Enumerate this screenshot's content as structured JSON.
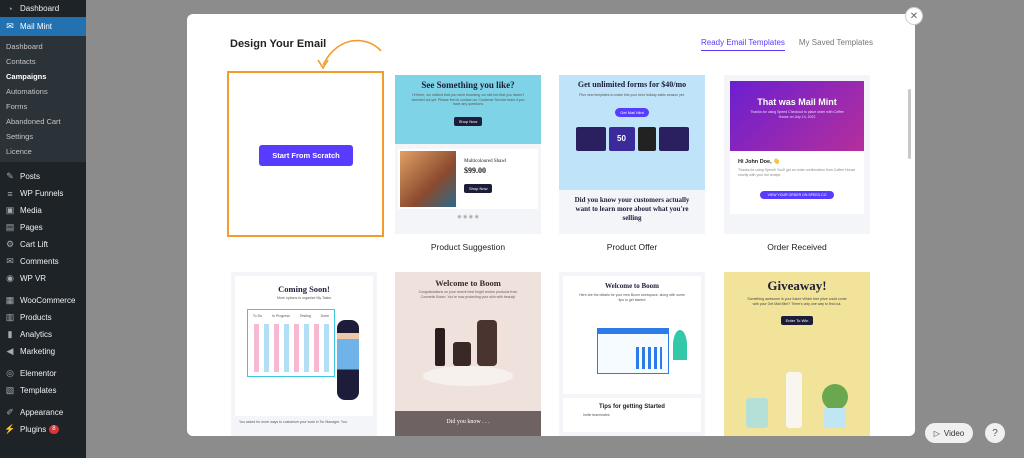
{
  "sidebar": {
    "top": [
      {
        "label": "Dashboard",
        "icon": "dashboard-icon",
        "glyph": "◔"
      },
      {
        "label": "Mail Mint",
        "icon": "mail-icon",
        "glyph": "✉",
        "active": true
      }
    ],
    "submenu": [
      "Dashboard",
      "Contacts",
      "Campaigns",
      "Automations",
      "Forms",
      "Abandoned Cart",
      "Settings",
      "Licence"
    ],
    "current_sub": "Campaigns",
    "items": [
      {
        "label": "Posts",
        "icon": "pin-icon",
        "glyph": "✎"
      },
      {
        "label": "WP Funnels",
        "icon": "funnel-icon",
        "glyph": "≡"
      },
      {
        "label": "Media",
        "icon": "media-icon",
        "glyph": "▣"
      },
      {
        "label": "Pages",
        "icon": "pages-icon",
        "glyph": "▤"
      },
      {
        "label": "Cart Lift",
        "icon": "cart-icon",
        "glyph": "⚙"
      },
      {
        "label": "Comments",
        "icon": "comment-icon",
        "glyph": "✉"
      },
      {
        "label": "WP VR",
        "icon": "vr-icon",
        "glyph": "◉"
      },
      {
        "label": "WooCommerce",
        "icon": "woo-icon",
        "glyph": "▦"
      },
      {
        "label": "Products",
        "icon": "products-icon",
        "glyph": "▥"
      },
      {
        "label": "Analytics",
        "icon": "analytics-icon",
        "glyph": "▮"
      },
      {
        "label": "Marketing",
        "icon": "megaphone-icon",
        "glyph": "◀"
      },
      {
        "label": "Elementor",
        "icon": "elementor-icon",
        "glyph": "◎"
      },
      {
        "label": "Templates",
        "icon": "templates-icon",
        "glyph": "▧"
      },
      {
        "label": "Appearance",
        "icon": "brush-icon",
        "glyph": "✐"
      },
      {
        "label": "Plugins",
        "icon": "plugin-icon",
        "glyph": "⚡",
        "badge": "8"
      }
    ]
  },
  "modal": {
    "title": "Design Your Email",
    "tabs": [
      "Ready Email Templates",
      "My Saved Templates"
    ],
    "active_tab": "Ready Email Templates",
    "scratch_button": "Start From Scratch",
    "accent": "#573bff",
    "highlight": "#f39c2c"
  },
  "templates": {
    "product_suggestion": {
      "label": "Product Suggestion",
      "headline": "See Something you like?",
      "body": "Hi there, we noticed that you were browsing our site but that you haven't checked out yet. Please feel to contact our Customer Service team if you have any questions",
      "cta": "Shop Now",
      "product": "Multicoloured Shawl",
      "price": "$99.00",
      "cta2": "Shop Now"
    },
    "product_offer": {
      "label": "Product Offer",
      "headline": "Get unlimited forms for $40/mo",
      "body": "Plus new templates to make this your best holiday sales season yet.",
      "cta": "Get Mail Mint",
      "stat": "50",
      "footer": "Did you know your customers actually want to learn more about what you're selling"
    },
    "order_received": {
      "label": "Order Received",
      "headline": "That was Mail Mint",
      "sub": "Thanks for using Speed Checkout to place order with Coffee House on July 14, 2022",
      "greeting": "Hi John Doe, 👋",
      "body": "Thanks for using Speed! You'll get an order confirmation from Coffee House shortly with your full receipt.",
      "cta": "VIEW YOUR ORDER ON SPEED.CO"
    },
    "coming_soon": {
      "headline": "Coming Soon!",
      "sub": "More options to organize My Tasks",
      "columns": [
        "To Do",
        "In Progress",
        "Testing",
        "Done"
      ],
      "footer": "You asked for more ways to customize your work in Tor Manager. You"
    },
    "welcome_boom": {
      "headline": "Welcome to Boom",
      "body": "Congratulations on your recent best bright review products from Cosmetic Boom. You're now protecting your skin with beauty!",
      "footer": "Did you know . . ."
    },
    "welcome_boom2": {
      "headline": "Welcome to Boom",
      "body": "Here are the details for your new Boom workspace, along with some tips to get started",
      "tips": "Tips for getting Started",
      "invite": "Invite teammates"
    },
    "giveaway": {
      "headline": "Giveaway!",
      "body": "Something awesome in your future Which free prize could come with your Get Mail Mint? There's only one way to find out.",
      "cta": "Enter To Win"
    }
  },
  "floating": {
    "video": "Video",
    "help": "?"
  }
}
